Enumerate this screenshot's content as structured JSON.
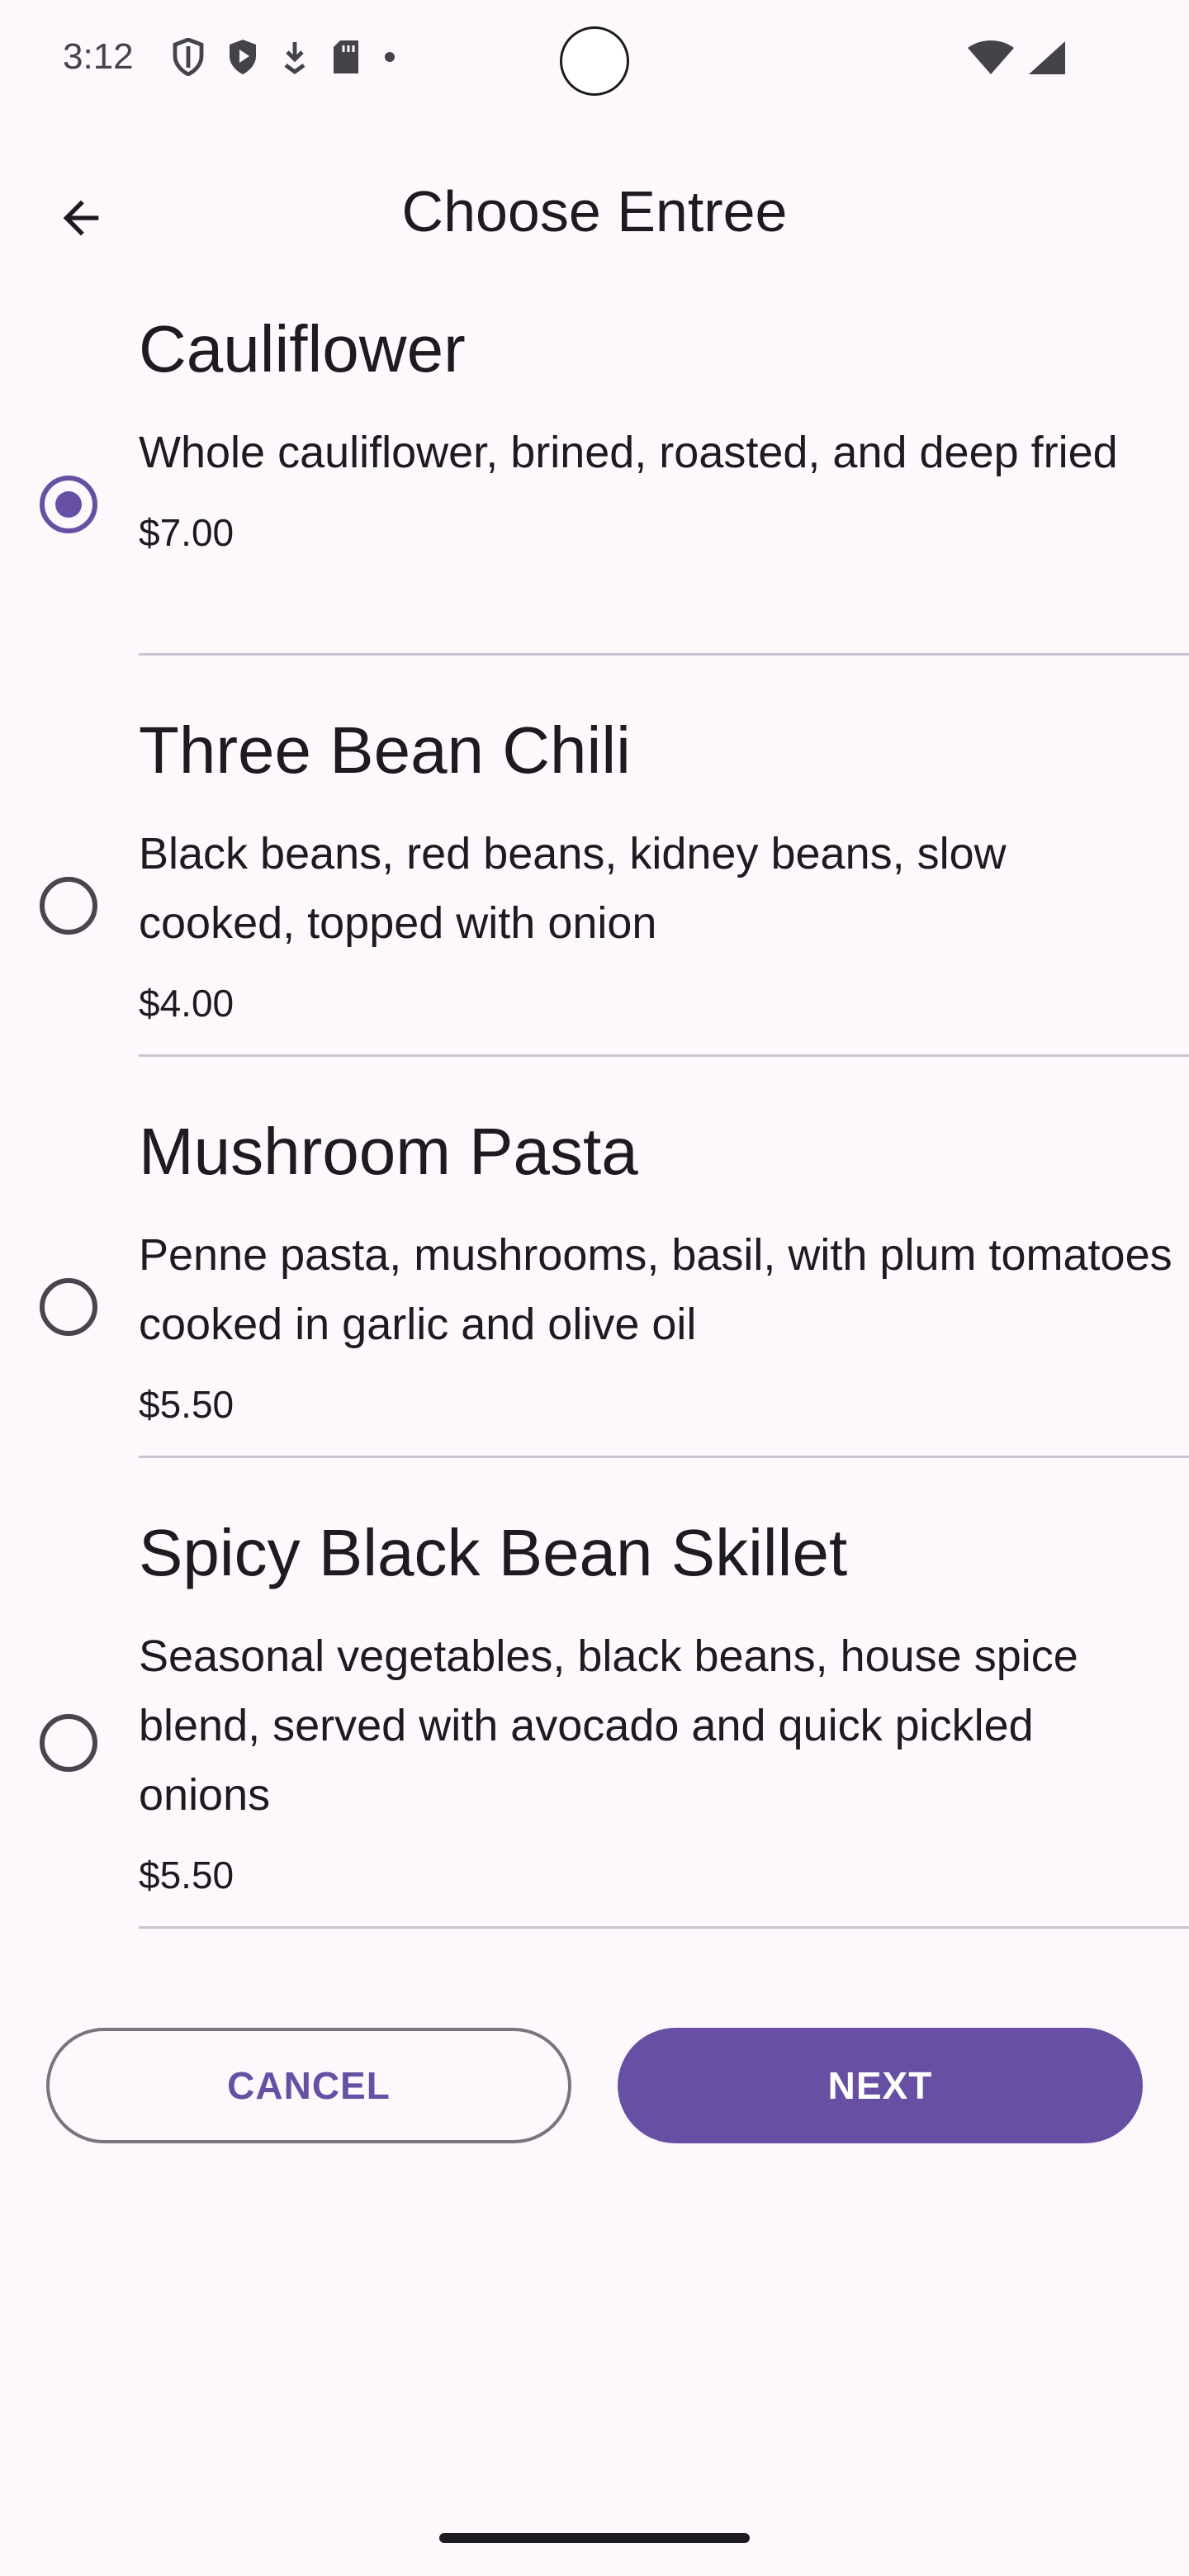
{
  "status_bar": {
    "time": "3:12",
    "icons": [
      "shield-icon",
      "play-shield-icon",
      "download-icon",
      "sd-card-icon",
      "dot-icon"
    ],
    "right_icons": [
      "wifi-icon",
      "cell-signal-icon"
    ]
  },
  "app_bar": {
    "title": "Choose Entree",
    "back_icon": "arrow-back-icon"
  },
  "entrees": [
    {
      "name": "Cauliflower",
      "description": "Whole cauliflower, brined, roasted, and deep fried",
      "price": "$7.00",
      "selected": true
    },
    {
      "name": "Three Bean Chili",
      "description": "Black beans, red beans, kidney beans, slow cooked, topped with onion",
      "price": "$4.00",
      "selected": false
    },
    {
      "name": "Mushroom Pasta",
      "description": "Penne pasta, mushrooms, basil, with plum tomatoes cooked in garlic and olive oil",
      "price": "$5.50",
      "selected": false
    },
    {
      "name": "Spicy Black Bean Skillet",
      "description": "Seasonal vegetables, black beans, house spice blend, served with avocado and quick pickled onions",
      "price": "$5.50",
      "selected": false
    }
  ],
  "actions": {
    "cancel_label": "CANCEL",
    "next_label": "NEXT"
  },
  "colors": {
    "accent": "#6750a4",
    "background": "#fdf8fc",
    "divider": "#cac4d0"
  }
}
